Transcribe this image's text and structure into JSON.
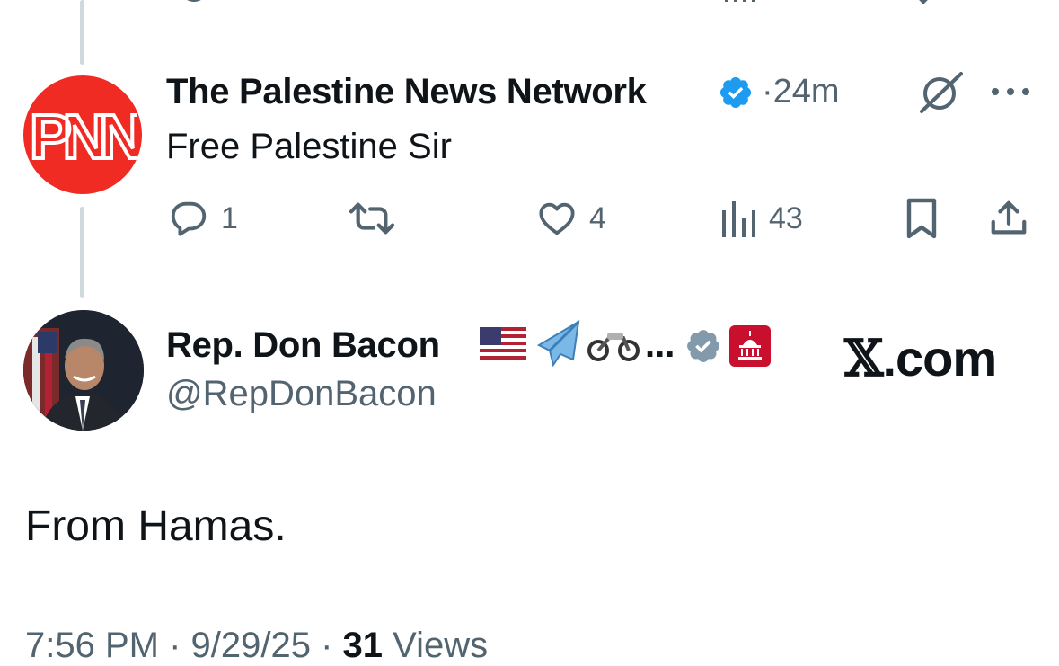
{
  "reply": {
    "display_name": "The Palestine News Network",
    "avatar_initials": "PNN",
    "verified": true,
    "separator": "·",
    "time": "24m",
    "text": "Free Palestine Sir",
    "actions": {
      "reply_count": "1",
      "repost_count": "",
      "like_count": "4",
      "view_count": "43"
    }
  },
  "main_tweet": {
    "display_name": "Rep. Don Bacon",
    "name_emojis": [
      "🇺🇸",
      "✈️",
      "🏍️"
    ],
    "name_truncation": "...",
    "verified_type": "government-gray",
    "affiliate_badge": "house-gop-badge",
    "handle": "@RepDonBacon",
    "text": "From Hamas.",
    "meta": {
      "time": "7:56 PM",
      "sep1": " · ",
      "date": "9/29/25",
      "sep2": " · ",
      "views_count": "31",
      "views_label": " Views"
    }
  },
  "watermark": {
    "glyph": "𝕏",
    "text": ".com"
  },
  "colors": {
    "text": "#0f1419",
    "secondary": "#536471",
    "verified_blue": "#1d9bf0",
    "verified_gray": "#829aab",
    "thread_line": "#cfd9de",
    "pnn_red": "#ef2b24",
    "gop_red": "#c8102e"
  },
  "icons": [
    "reply-icon",
    "repost-icon",
    "like-icon",
    "views-icon",
    "bookmark-icon",
    "share-icon",
    "grok-icon",
    "more-icon",
    "verified-badge-icon"
  ]
}
